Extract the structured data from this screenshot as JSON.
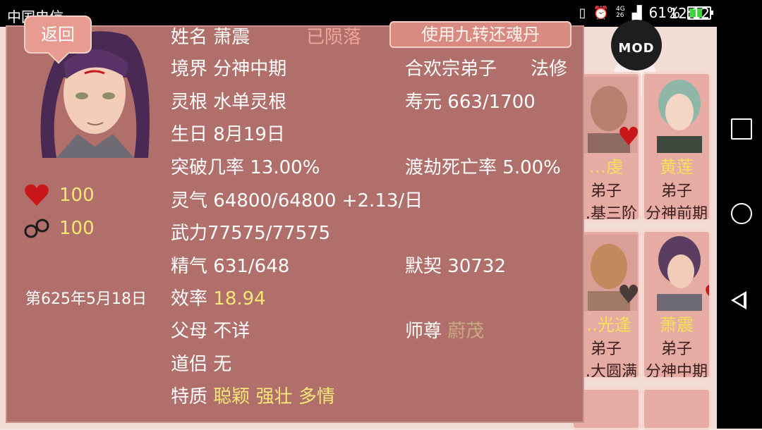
{
  "status_bar": {
    "carrier": "中国电信",
    "net_top": "4G",
    "net_bottom": "26",
    "battery": "61%",
    "time": "12:12"
  },
  "background": {
    "mod_button": "MOD",
    "cards": [
      {
        "name": "…虔",
        "role": "弟子",
        "rank": "…基三阶"
      },
      {
        "name": "黄莲",
        "role": "弟子",
        "rank": "分神前期"
      },
      {
        "name": "…光逢",
        "role": "弟子",
        "rank": "…大圆满"
      },
      {
        "name": "萧震",
        "role": "弟子",
        "rank": "分神中期"
      }
    ]
  },
  "panel": {
    "back_label": "返回",
    "use_item_label": "使用九转还魂丹",
    "favor": "100",
    "bond": "100",
    "date": "第625年5月18日",
    "name_label": "姓名",
    "name_value": "萧震",
    "status": "已陨落",
    "realm_label": "境界",
    "realm_value": "分神中期",
    "sect": "合欢宗弟子",
    "class": "法修",
    "root_label": "灵根",
    "root_value": "水单灵根",
    "lifespan_label": "寿元",
    "lifespan_value": "663/1700",
    "birthday_label": "生日",
    "birthday_value": "8月19日",
    "breakthrough_label": "突破几率",
    "breakthrough_value": "13.00%",
    "tribulation_label": "渡劫死亡率",
    "tribulation_value": "5.00%",
    "qi_label": "灵气",
    "qi_value": "64800/64800 +2.13/日",
    "power_label": "武力",
    "power_value": "77575/77575",
    "essence_label": "精气",
    "essence_value": "631/648",
    "rapport_label": "默契",
    "rapport_value": "30732",
    "efficiency_label": "效率",
    "efficiency_value": "18.94",
    "parents_label": "父母",
    "parents_value": "不详",
    "master_label": "师尊",
    "master_value": "蔚茂",
    "partner_label": "道侣",
    "partner_value": "无",
    "traits_label": "特质",
    "traits": [
      "聪颖",
      "强壮",
      "多情"
    ]
  }
}
